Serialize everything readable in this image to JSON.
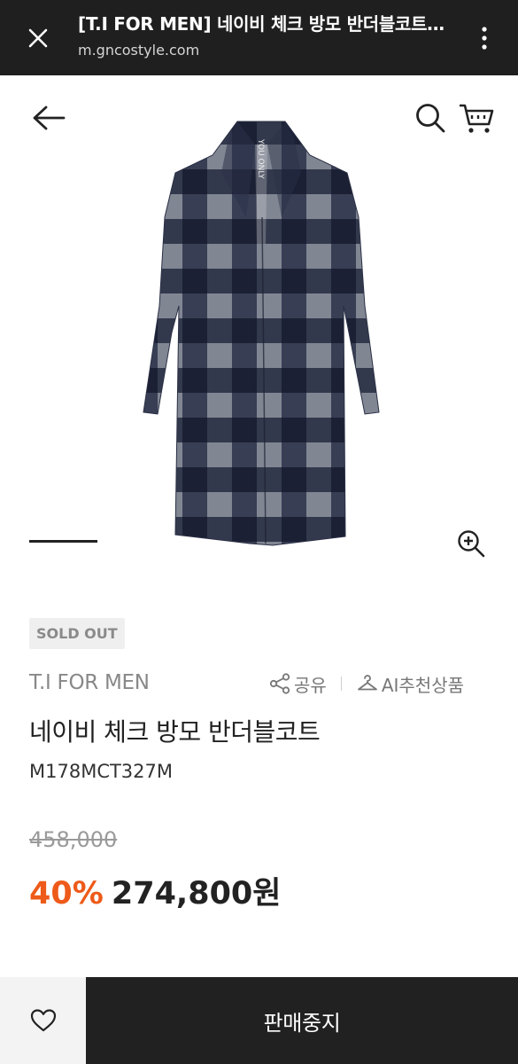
{
  "browser": {
    "title": "[T.I FOR MEN] 네이비 체크 방모 반더블코트…",
    "url": "m.gncostyle.com"
  },
  "icons": {
    "close": "close-icon",
    "more": "more-vertical-icon",
    "back": "arrow-left-icon",
    "search": "search-icon",
    "cart": "cart-icon",
    "zoom": "zoom-in-icon",
    "share": "share-icon",
    "ai": "hanger-icon",
    "wish": "heart-icon"
  },
  "product": {
    "badge": "SOLD OUT",
    "brand": "T.I FOR MEN",
    "name": "네이비 체크 방모 반더블코트",
    "code": "M178MCT327M",
    "original_price": "458,000",
    "discount": "40%",
    "price": "274,800원",
    "image_label": "YOU ONLY"
  },
  "actions": {
    "share_label": "공유",
    "ai_label": "AI추천상품"
  },
  "bottom": {
    "cta_label": "판매중지"
  },
  "colors": {
    "accent_discount": "#ee5a19",
    "cta_bg": "#212121",
    "browser_bg": "#1f1f1f"
  }
}
